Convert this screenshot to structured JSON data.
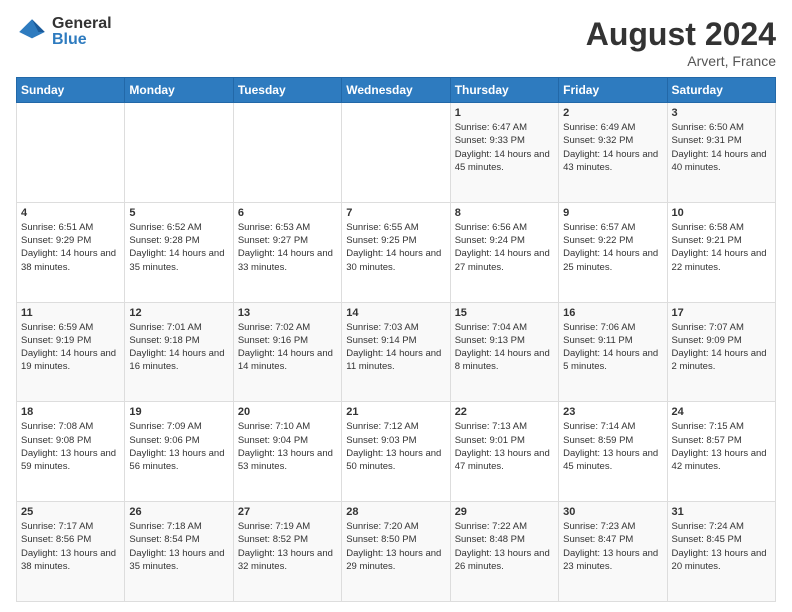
{
  "logo": {
    "general": "General",
    "blue": "Blue"
  },
  "header": {
    "month_year": "August 2024",
    "location": "Arvert, France"
  },
  "days_of_week": [
    "Sunday",
    "Monday",
    "Tuesday",
    "Wednesday",
    "Thursday",
    "Friday",
    "Saturday"
  ],
  "weeks": [
    [
      {
        "day": "",
        "info": ""
      },
      {
        "day": "",
        "info": ""
      },
      {
        "day": "",
        "info": ""
      },
      {
        "day": "",
        "info": ""
      },
      {
        "day": "1",
        "info": "Sunrise: 6:47 AM\nSunset: 9:33 PM\nDaylight: 14 hours and 45 minutes."
      },
      {
        "day": "2",
        "info": "Sunrise: 6:49 AM\nSunset: 9:32 PM\nDaylight: 14 hours and 43 minutes."
      },
      {
        "day": "3",
        "info": "Sunrise: 6:50 AM\nSunset: 9:31 PM\nDaylight: 14 hours and 40 minutes."
      }
    ],
    [
      {
        "day": "4",
        "info": "Sunrise: 6:51 AM\nSunset: 9:29 PM\nDaylight: 14 hours and 38 minutes."
      },
      {
        "day": "5",
        "info": "Sunrise: 6:52 AM\nSunset: 9:28 PM\nDaylight: 14 hours and 35 minutes."
      },
      {
        "day": "6",
        "info": "Sunrise: 6:53 AM\nSunset: 9:27 PM\nDaylight: 14 hours and 33 minutes."
      },
      {
        "day": "7",
        "info": "Sunrise: 6:55 AM\nSunset: 9:25 PM\nDaylight: 14 hours and 30 minutes."
      },
      {
        "day": "8",
        "info": "Sunrise: 6:56 AM\nSunset: 9:24 PM\nDaylight: 14 hours and 27 minutes."
      },
      {
        "day": "9",
        "info": "Sunrise: 6:57 AM\nSunset: 9:22 PM\nDaylight: 14 hours and 25 minutes."
      },
      {
        "day": "10",
        "info": "Sunrise: 6:58 AM\nSunset: 9:21 PM\nDaylight: 14 hours and 22 minutes."
      }
    ],
    [
      {
        "day": "11",
        "info": "Sunrise: 6:59 AM\nSunset: 9:19 PM\nDaylight: 14 hours and 19 minutes."
      },
      {
        "day": "12",
        "info": "Sunrise: 7:01 AM\nSunset: 9:18 PM\nDaylight: 14 hours and 16 minutes."
      },
      {
        "day": "13",
        "info": "Sunrise: 7:02 AM\nSunset: 9:16 PM\nDaylight: 14 hours and 14 minutes."
      },
      {
        "day": "14",
        "info": "Sunrise: 7:03 AM\nSunset: 9:14 PM\nDaylight: 14 hours and 11 minutes."
      },
      {
        "day": "15",
        "info": "Sunrise: 7:04 AM\nSunset: 9:13 PM\nDaylight: 14 hours and 8 minutes."
      },
      {
        "day": "16",
        "info": "Sunrise: 7:06 AM\nSunset: 9:11 PM\nDaylight: 14 hours and 5 minutes."
      },
      {
        "day": "17",
        "info": "Sunrise: 7:07 AM\nSunset: 9:09 PM\nDaylight: 14 hours and 2 minutes."
      }
    ],
    [
      {
        "day": "18",
        "info": "Sunrise: 7:08 AM\nSunset: 9:08 PM\nDaylight: 13 hours and 59 minutes."
      },
      {
        "day": "19",
        "info": "Sunrise: 7:09 AM\nSunset: 9:06 PM\nDaylight: 13 hours and 56 minutes."
      },
      {
        "day": "20",
        "info": "Sunrise: 7:10 AM\nSunset: 9:04 PM\nDaylight: 13 hours and 53 minutes."
      },
      {
        "day": "21",
        "info": "Sunrise: 7:12 AM\nSunset: 9:03 PM\nDaylight: 13 hours and 50 minutes."
      },
      {
        "day": "22",
        "info": "Sunrise: 7:13 AM\nSunset: 9:01 PM\nDaylight: 13 hours and 47 minutes."
      },
      {
        "day": "23",
        "info": "Sunrise: 7:14 AM\nSunset: 8:59 PM\nDaylight: 13 hours and 45 minutes."
      },
      {
        "day": "24",
        "info": "Sunrise: 7:15 AM\nSunset: 8:57 PM\nDaylight: 13 hours and 42 minutes."
      }
    ],
    [
      {
        "day": "25",
        "info": "Sunrise: 7:17 AM\nSunset: 8:56 PM\nDaylight: 13 hours and 38 minutes."
      },
      {
        "day": "26",
        "info": "Sunrise: 7:18 AM\nSunset: 8:54 PM\nDaylight: 13 hours and 35 minutes."
      },
      {
        "day": "27",
        "info": "Sunrise: 7:19 AM\nSunset: 8:52 PM\nDaylight: 13 hours and 32 minutes."
      },
      {
        "day": "28",
        "info": "Sunrise: 7:20 AM\nSunset: 8:50 PM\nDaylight: 13 hours and 29 minutes."
      },
      {
        "day": "29",
        "info": "Sunrise: 7:22 AM\nSunset: 8:48 PM\nDaylight: 13 hours and 26 minutes."
      },
      {
        "day": "30",
        "info": "Sunrise: 7:23 AM\nSunset: 8:47 PM\nDaylight: 13 hours and 23 minutes."
      },
      {
        "day": "31",
        "info": "Sunrise: 7:24 AM\nSunset: 8:45 PM\nDaylight: 13 hours and 20 minutes."
      }
    ]
  ]
}
